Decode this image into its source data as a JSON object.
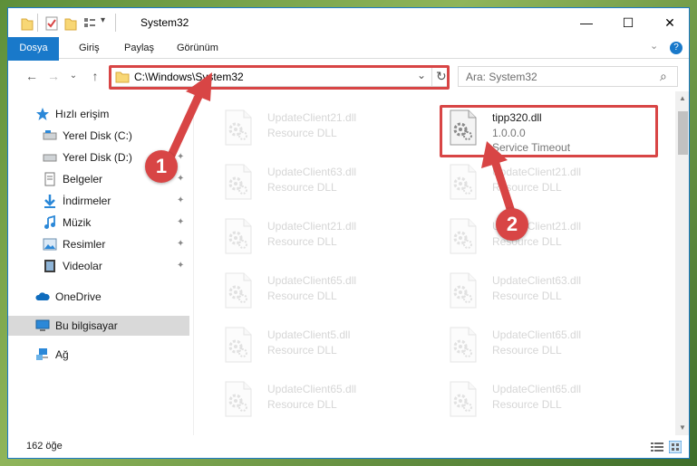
{
  "window": {
    "title": "System32",
    "minimize": "—",
    "maximize": "☐",
    "close": "✕"
  },
  "ribbon": {
    "tabs": [
      "Dosya",
      "Giriş",
      "Paylaş",
      "Görünüm"
    ],
    "help_icon": "?"
  },
  "nav": {
    "back": "←",
    "forward": "→",
    "recent": "⌄",
    "up": "↑",
    "address": "C:\\Windows\\System32",
    "dropdown": "⌄",
    "refresh": "↻",
    "search_placeholder": "Ara: System32",
    "search_icon": "⌕"
  },
  "sidebar": {
    "items": [
      {
        "label": "Hızlı erişim",
        "icon": "star-icon"
      },
      {
        "label": "Yerel Disk (C:)",
        "icon": "drive-icon"
      },
      {
        "label": "Yerel Disk (D:)",
        "icon": "drive-icon"
      },
      {
        "label": "Belgeler",
        "icon": "documents-icon"
      },
      {
        "label": "İndirmeler",
        "icon": "download-icon"
      },
      {
        "label": "Müzik",
        "icon": "music-icon"
      },
      {
        "label": "Resimler",
        "icon": "pictures-icon"
      },
      {
        "label": "Videolar",
        "icon": "videos-icon"
      },
      {
        "label": "OneDrive",
        "icon": "cloud-icon"
      },
      {
        "label": "Bu bilgisayar",
        "icon": "computer-icon"
      },
      {
        "label": "Ağ",
        "icon": "network-icon"
      }
    ],
    "pin_glyph": "📌"
  },
  "files": {
    "left": [
      {
        "name": "UpdateClient21.dll",
        "type": "Resource DLL"
      },
      {
        "name": "UpdateClient63.dll",
        "type": "Resource DLL"
      },
      {
        "name": "UpdateClient21.dll",
        "type": "Resource DLL"
      },
      {
        "name": "UpdateClient65.dll",
        "type": "Resource DLL"
      },
      {
        "name": "UpdateClient5.dll",
        "type": "Resource DLL"
      },
      {
        "name": "UpdateClient65.dll",
        "type": "Resource DLL"
      }
    ],
    "right": [
      {
        "name": "tipp320.dll",
        "version": "1.0.0.0",
        "description": "Service Timeout"
      },
      {
        "name": "UpdateClient21.dll",
        "type": "Resource DLL"
      },
      {
        "name": "UpdateClient21.dll",
        "type": "Resource DLL"
      },
      {
        "name": "UpdateClient63.dll",
        "type": "Resource DLL"
      },
      {
        "name": "UpdateClient65.dll",
        "type": "Resource DLL"
      },
      {
        "name": "UpdateClient65.dll",
        "type": "Resource DLL"
      }
    ]
  },
  "status": {
    "item_count": "162 öğe"
  },
  "annotations": {
    "step1": "1",
    "step2": "2",
    "color": "#d84545"
  },
  "colors": {
    "accent": "#1979ca",
    "highlight_box": "#d84545"
  }
}
